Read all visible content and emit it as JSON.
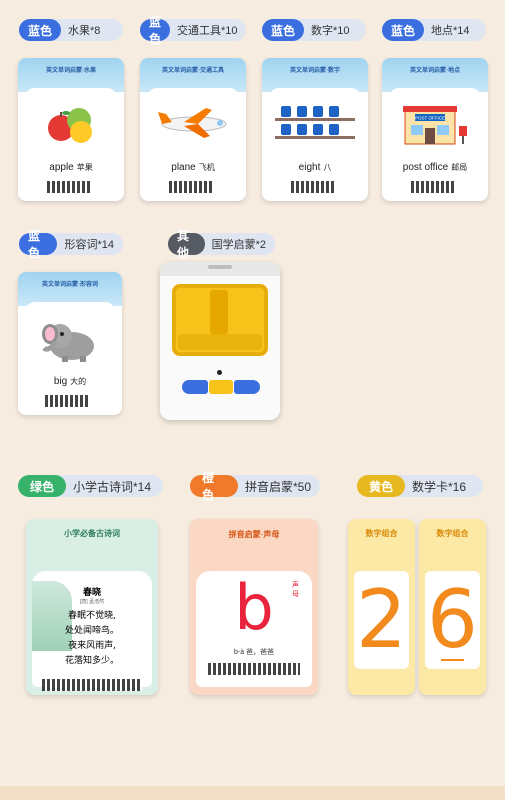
{
  "tags": {
    "fruit": {
      "pill": "蓝色",
      "text": "水果*8"
    },
    "transport": {
      "pill": "蓝色",
      "text": "交通工具*10"
    },
    "number": {
      "pill": "蓝色",
      "text": "数字*10"
    },
    "place": {
      "pill": "蓝色",
      "text": "地点*14"
    },
    "adjective": {
      "pill": "蓝色",
      "text": "形容词*14"
    },
    "other": {
      "pill": "其他",
      "text": "国学启蒙*2"
    },
    "poem": {
      "pill": "绿色",
      "text": "小学古诗词*14"
    },
    "pinyin": {
      "pill": "橙色",
      "text": "拼音启蒙*50"
    },
    "digitcard": {
      "pill": "黄色",
      "text": "数学卡*16"
    }
  },
  "cards": {
    "fruit": {
      "header": "英文单词启蒙·水果",
      "word": "apple",
      "cn": "苹果"
    },
    "transport": {
      "header": "英文单词启蒙·交通工具",
      "word": "plane",
      "cn": "飞机"
    },
    "number": {
      "header": "英文单词启蒙·数字",
      "word": "eight",
      "cn": "八"
    },
    "place": {
      "header": "英文单词启蒙·地点",
      "word": "post office",
      "cn": "邮局",
      "sign": "POST OFFICE"
    },
    "adjective": {
      "header": "英文单词启蒙·形容词",
      "word": "big",
      "cn": "大的"
    },
    "poem": {
      "header": "小学必备古诗词",
      "title": "春晓",
      "author": "[唐] 孟浩然",
      "lines": [
        "春眠不觉晓,",
        "处处闻啼鸟。",
        "夜来风雨声,",
        "花落知多少。"
      ]
    },
    "pinyin": {
      "header": "拼音启蒙·声母",
      "letter": "b",
      "side": "声母",
      "example": "b-à 爸，爸爸"
    },
    "digit2": {
      "header": "数字组合",
      "digit": "2"
    },
    "digit6": {
      "header": "数字组合",
      "digit": "6"
    }
  },
  "colors": {
    "blue": "#3b6fe0",
    "gray": "#555a63",
    "green": "#36b26a",
    "orange": "#f07a2a",
    "yellow": "#e8b820",
    "pinyinRed": "#e8243c",
    "digitOrange": "#f28a1e"
  }
}
